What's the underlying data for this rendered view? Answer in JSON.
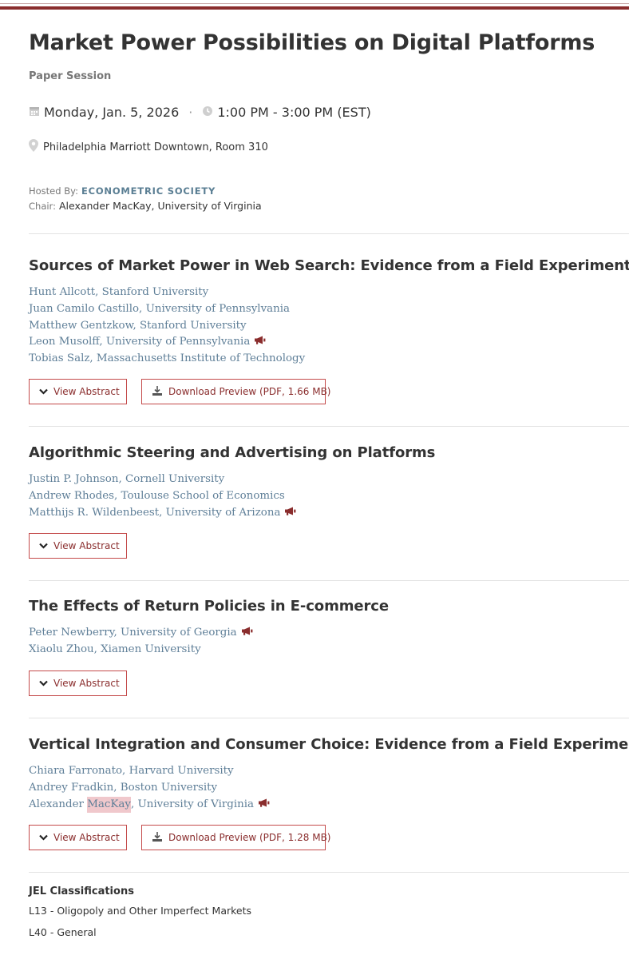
{
  "session": {
    "title": "Market Power Possibilities on Digital Platforms",
    "type": "Paper Session",
    "date": "Monday, Jan. 5, 2026",
    "separator": "·",
    "time": "1:00 PM - 3:00 PM (EST)",
    "location": "Philadelphia Marriott Downtown, Room 310",
    "hosted_by_label": "Hosted By:",
    "hosted_by": "ECONOMETRIC SOCIETY",
    "chair_label": "Chair:",
    "chair": "Alexander MacKay, University of Virginia"
  },
  "buttons": {
    "view_abstract": "View Abstract"
  },
  "papers": [
    {
      "title": "Sources of Market Power in Web Search: Evidence from a Field Experiment",
      "authors": [
        "Hunt Allcott, Stanford University",
        "Juan Camilo Castillo, University of Pennsylvania",
        "Matthew Gentzkow, Stanford University",
        "Leon Musolff, University of Pennsylvania",
        "Tobias Salz, Massachusetts Institute of Technology"
      ],
      "download_label": "Download Preview (PDF, 1.66 MB)"
    },
    {
      "title": "Algorithmic Steering and Advertising on Platforms",
      "authors": [
        "Justin P. Johnson, Cornell University",
        "Andrew Rhodes, Toulouse School of Economics",
        "Matthijs R. Wildenbeest, University of Arizona"
      ]
    },
    {
      "title": "The Effects of Return Policies in E-commerce",
      "authors": [
        "Peter Newberry, University of Georgia",
        "Xiaolu Zhou, Xiamen University"
      ]
    },
    {
      "title": "Vertical Integration and Consumer Choice: Evidence from a Field Experiment",
      "authors": [
        "Chiara Farronato, Harvard University",
        "Andrey Fradkin, Boston University"
      ],
      "last_author": {
        "first": "Alexander ",
        "highlighted": "MacKay",
        "rest": ", University of Virginia"
      },
      "download_label": "Download Preview (PDF, 1.28 MB)"
    }
  ],
  "jel": {
    "heading": "JEL Classifications",
    "items": [
      "L13 - Oligopoly and Other Imperfect Markets",
      "L40 - General"
    ]
  },
  "colors": {
    "accent": "#8a2d2d",
    "link": "#5f7f98",
    "highlight": "#f0c8cc"
  },
  "icons": [
    "calendar-icon",
    "clock-icon",
    "map-pin-icon",
    "megaphone-icon",
    "chevron-down-icon",
    "download-icon"
  ]
}
